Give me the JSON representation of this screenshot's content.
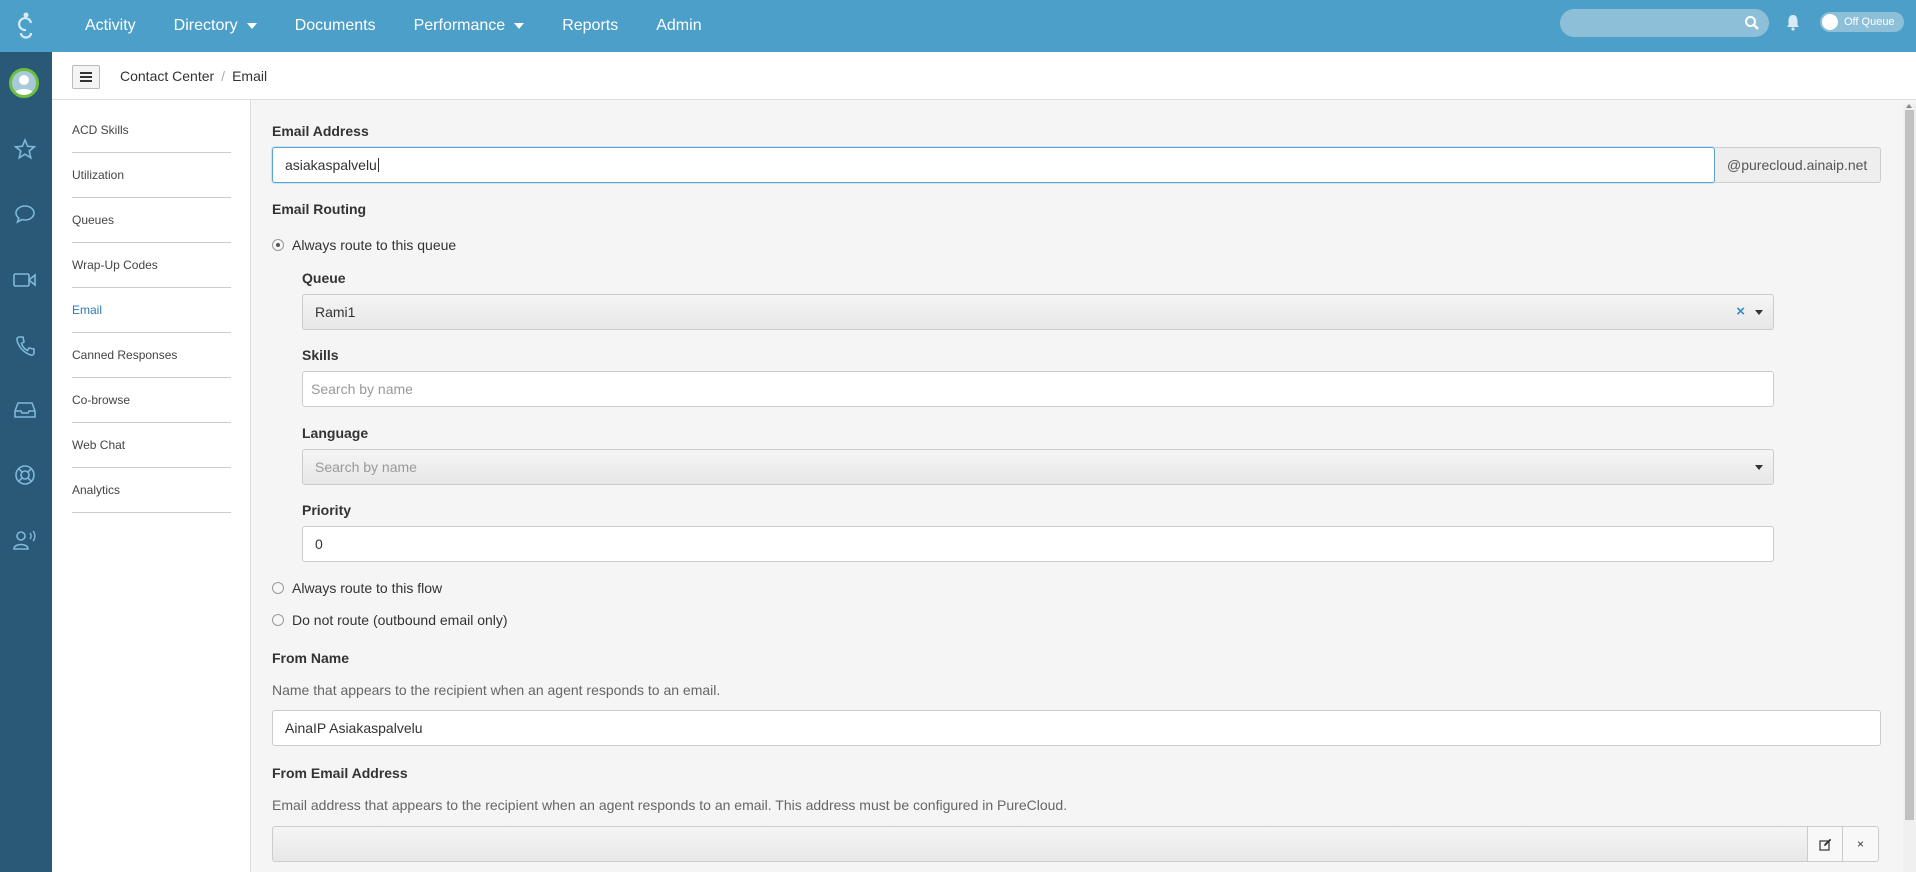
{
  "topbar": {
    "nav": [
      {
        "label": "Activity",
        "dropdown": false
      },
      {
        "label": "Directory",
        "dropdown": true
      },
      {
        "label": "Documents",
        "dropdown": false
      },
      {
        "label": "Performance",
        "dropdown": true
      },
      {
        "label": "Reports",
        "dropdown": false
      },
      {
        "label": "Admin",
        "dropdown": false
      }
    ],
    "queue_status": "Off Queue",
    "colors": {
      "bar": "#4b9fc8",
      "rail": "#2a5978",
      "accent": "#2a7ab8"
    }
  },
  "rail": {
    "icons": [
      "avatar",
      "star-icon",
      "chat-icon",
      "video-icon",
      "phone-icon",
      "inbox-icon",
      "lifebuoy-icon",
      "user-voice-icon"
    ]
  },
  "breadcrumb": {
    "parent": "Contact Center",
    "current": "Email"
  },
  "subnav": {
    "items": [
      "ACD Skills",
      "Utilization",
      "Queues",
      "Wrap-Up Codes",
      "Email",
      "Canned Responses",
      "Co-browse",
      "Web Chat",
      "Analytics"
    ],
    "active": "Email"
  },
  "form": {
    "email_address_label": "Email Address",
    "email_address_value": "asiakaspalvelu",
    "email_domain": "@purecloud.ainaip.net",
    "routing_label": "Email Routing",
    "route_queue_label": "Always route to this queue",
    "queue_label": "Queue",
    "queue_value": "Rami1",
    "skills_label": "Skills",
    "skills_placeholder": "Search by name",
    "language_label": "Language",
    "language_placeholder": "Search by name",
    "priority_label": "Priority",
    "priority_value": "0",
    "route_flow_label": "Always route to this flow",
    "no_route_label": "Do not route (outbound email only)",
    "selected_routing": "queue",
    "from_name_label": "From Name",
    "from_name_help": "Name that appears to the recipient when an agent responds to an email.",
    "from_name_value": "AinaIP Asiakaspalvelu",
    "from_email_label": "From Email Address",
    "from_email_help": "Email address that appears to the recipient when an agent responds to an email. This address must be configured in PureCloud.",
    "from_email_value": "",
    "clear_label": "×"
  }
}
